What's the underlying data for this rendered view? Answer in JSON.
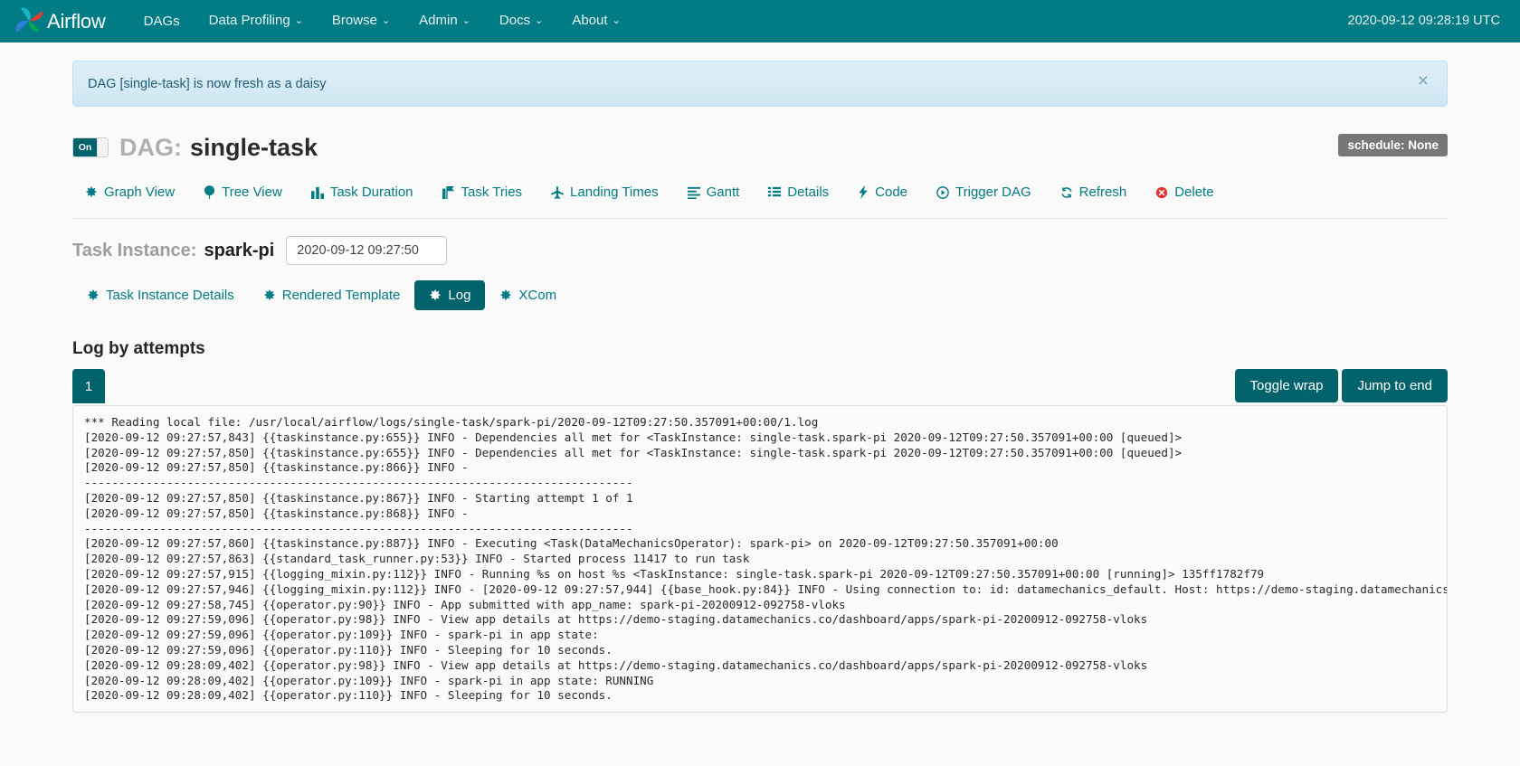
{
  "navbar": {
    "brand": "Airflow",
    "links": [
      {
        "label": "DAGs",
        "caret": false
      },
      {
        "label": "Data Profiling",
        "caret": true
      },
      {
        "label": "Browse",
        "caret": true
      },
      {
        "label": "Admin",
        "caret": true
      },
      {
        "label": "Docs",
        "caret": true
      },
      {
        "label": "About",
        "caret": true
      }
    ],
    "clock": "2020-09-12 09:28:19 UTC",
    "caret_glyph": "⌄",
    "background": "#017b84"
  },
  "alert": {
    "message": "DAG [single-task] is now fresh as a daisy",
    "close_glyph": "×"
  },
  "dag": {
    "toggle_state": "On",
    "label": "DAG:",
    "name": "single-task",
    "schedule_badge": "schedule: None"
  },
  "dag_tabs": [
    {
      "label": "Graph View",
      "icon": "asterisk-icon"
    },
    {
      "label": "Tree View",
      "icon": "tree-icon"
    },
    {
      "label": "Task Duration",
      "icon": "bar-chart-icon"
    },
    {
      "label": "Task Tries",
      "icon": "chart-flag-icon"
    },
    {
      "label": "Landing Times",
      "icon": "plane-icon"
    },
    {
      "label": "Gantt",
      "icon": "align-left-icon"
    },
    {
      "label": "Details",
      "icon": "list-icon"
    },
    {
      "label": "Code",
      "icon": "bolt-icon"
    },
    {
      "label": "Trigger DAG",
      "icon": "play-circle-icon"
    },
    {
      "label": "Refresh",
      "icon": "refresh-icon"
    },
    {
      "label": "Delete",
      "icon": "delete-circle-icon"
    }
  ],
  "task_instance": {
    "label": "Task Instance:",
    "name": "spark-pi",
    "execution_date": "2020-09-12 09:27:50",
    "execution_date_placeholder": "2020-09-12 09:27:50"
  },
  "ti_tabs": [
    {
      "label": "Task Instance Details",
      "icon": "asterisk-icon",
      "active": false
    },
    {
      "label": "Rendered Template",
      "icon": "asterisk-icon",
      "active": false
    },
    {
      "label": "Log",
      "icon": "asterisk-icon",
      "active": true
    },
    {
      "label": "XCom",
      "icon": "asterisk-icon",
      "active": false
    }
  ],
  "log_section": {
    "heading": "Log by attempts",
    "attempt_tab": "1",
    "toggle_wrap_label": "Toggle wrap",
    "jump_to_end_label": "Jump to end",
    "content": "*** Reading local file: /usr/local/airflow/logs/single-task/spark-pi/2020-09-12T09:27:50.357091+00:00/1.log\n[2020-09-12 09:27:57,843] {{taskinstance.py:655}} INFO - Dependencies all met for <TaskInstance: single-task.spark-pi 2020-09-12T09:27:50.357091+00:00 [queued]>\n[2020-09-12 09:27:57,850] {{taskinstance.py:655}} INFO - Dependencies all met for <TaskInstance: single-task.spark-pi 2020-09-12T09:27:50.357091+00:00 [queued]>\n[2020-09-12 09:27:57,850] {{taskinstance.py:866}} INFO - \n--------------------------------------------------------------------------------\n[2020-09-12 09:27:57,850] {{taskinstance.py:867}} INFO - Starting attempt 1 of 1\n[2020-09-12 09:27:57,850] {{taskinstance.py:868}} INFO - \n--------------------------------------------------------------------------------\n[2020-09-12 09:27:57,860] {{taskinstance.py:887}} INFO - Executing <Task(DataMechanicsOperator): spark-pi> on 2020-09-12T09:27:50.357091+00:00\n[2020-09-12 09:27:57,863] {{standard_task_runner.py:53}} INFO - Started process 11417 to run task\n[2020-09-12 09:27:57,915] {{logging_mixin.py:112}} INFO - Running %s on host %s <TaskInstance: single-task.spark-pi 2020-09-12T09:27:50.357091+00:00 [running]> 135ff1782f79\n[2020-09-12 09:27:57,946] {{logging_mixin.py:112}} INFO - [2020-09-12 09:27:57,944] {{base_hook.py:84}} INFO - Using connection to: id: datamechanics_default. Host: https://demo-staging.datamechanics.co/, Port\n[2020-09-12 09:27:58,745] {{operator.py:90}} INFO - App submitted with app_name: spark-pi-20200912-092758-vloks\n[2020-09-12 09:27:59,096] {{operator.py:98}} INFO - View app details at https://demo-staging.datamechanics.co/dashboard/apps/spark-pi-20200912-092758-vloks\n[2020-09-12 09:27:59,096] {{operator.py:109}} INFO - spark-pi in app state:\n[2020-09-12 09:27:59,096] {{operator.py:110}} INFO - Sleeping for 10 seconds.\n[2020-09-12 09:28:09,402] {{operator.py:98}} INFO - View app details at https://demo-staging.datamechanics.co/dashboard/apps/spark-pi-20200912-092758-vloks\n[2020-09-12 09:28:09,402] {{operator.py:109}} INFO - spark-pi in app state: RUNNING\n[2020-09-12 09:28:09,402] {{operator.py:110}} INFO - Sleeping for 10 seconds."
  }
}
